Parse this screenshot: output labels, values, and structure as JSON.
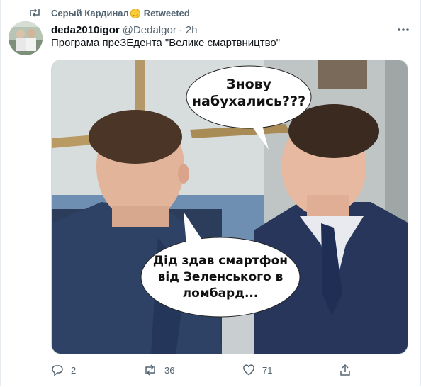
{
  "retweet": {
    "user": "Серый Кардинал",
    "label": "Retweeted",
    "icon": "retweet-icon"
  },
  "tweet": {
    "author_name": "deda2010igor",
    "handle": "@Dedalgor",
    "separator": "·",
    "time": "2h",
    "text": "Програма преЗЕдента \"Велике смартвництво\""
  },
  "meme": {
    "bubble_top_line1": "Знову",
    "bubble_top_line2": "набухались???",
    "bubble_bottom_line1": "Дід здав смартфон",
    "bubble_bottom_line2": "від Зеленського в",
    "bubble_bottom_line3": "ломбард..."
  },
  "actions": {
    "replies": "2",
    "retweets": "36",
    "likes": "71"
  },
  "colors": {
    "text": "#0f1419",
    "secondary": "#536471",
    "border": "#cfd9de"
  }
}
